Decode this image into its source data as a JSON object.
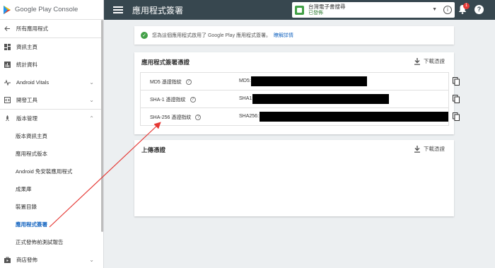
{
  "brand": {
    "name": "Google Play Console"
  },
  "sidebar": {
    "items": [
      {
        "label": "所有應用程式",
        "icon": "back-arrow-icon"
      },
      {
        "label": "資訊主頁",
        "icon": "dashboard-icon"
      },
      {
        "label": "統計資料",
        "icon": "bar-chart-icon"
      },
      {
        "label": "Android Vitals",
        "icon": "pulse-icon"
      },
      {
        "label": "開發工具",
        "icon": "code-icon"
      },
      {
        "label": "版本管理",
        "icon": "rocket-icon"
      },
      {
        "label": "版本資訊主頁"
      },
      {
        "label": "應用程式版本"
      },
      {
        "label": "Android 免安裝應用程式"
      },
      {
        "label": "成果庫"
      },
      {
        "label": "裝置目錄"
      },
      {
        "label": "應用程式簽署"
      },
      {
        "label": "正式發佈前測試報告"
      },
      {
        "label": "商店發佈",
        "icon": "store-icon"
      }
    ]
  },
  "topbar": {
    "title": "應用程式簽署",
    "app_name": "台灣電子書搜尋",
    "app_status": "已發佈",
    "notification_count": "1"
  },
  "banner": {
    "text": "您為這個應用程式啟用了 Google Play 應用程式簽署。",
    "link": "瞭解詳情"
  },
  "signing_card": {
    "title": "應用程式簽署憑證",
    "download_label": "下載憑證",
    "rows": [
      {
        "label": "MD5 憑證指紋",
        "key": "MD5:"
      },
      {
        "label": "SHA-1 憑證指紋",
        "key": "SHA1:"
      },
      {
        "label": "SHA-256 憑證指紋",
        "key": "SHA256:"
      }
    ]
  },
  "upload_card": {
    "title": "上傳憑證",
    "download_label": "下載憑證"
  },
  "colors": {
    "topbar": "#37474f",
    "active": "#1565c0",
    "success": "#43a047",
    "annotation_arrow": "#e53935"
  }
}
